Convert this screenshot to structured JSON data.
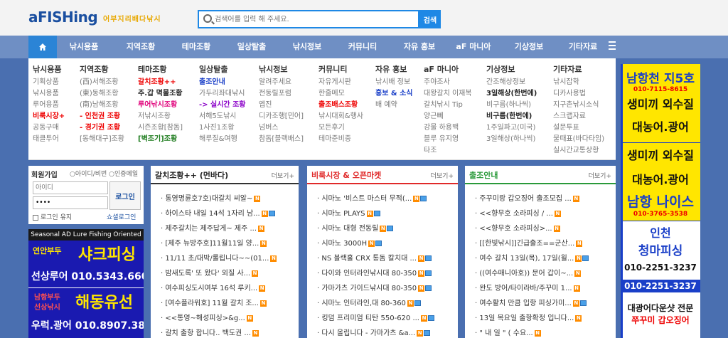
{
  "header": {
    "logo": "aFISHing",
    "logo_sub": "어부지리배다낚시",
    "search_placeholder": "검색어를 입력 해 주세요.",
    "search_button": "검색"
  },
  "nav": {
    "items": [
      "낚시용품",
      "지역조황",
      "테마조황",
      "일상탈출",
      "낚시정보",
      "커뮤니티",
      "자유 홍보",
      "aF 마니아",
      "기상정보",
      "기타자료"
    ]
  },
  "mega": {
    "columns": [
      {
        "title": "낚시용품",
        "items": [
          "기획상품",
          "낚시용품",
          "루어용품",
          "비룩시장+",
          "공동구매",
          "태클투어"
        ]
      },
      {
        "title": "지역조황",
        "items": [
          "(西)서해조황",
          "(東)동해조황",
          "(南)남해조황",
          "- 인천권 조황",
          "- 경기권 조황",
          "[동해대구]조황"
        ]
      },
      {
        "title": "테마조황",
        "items": [
          "갈치조황++",
          "주.갑 멱물조황",
          "루어낚시조황",
          "저낚시조황",
          "시즌조황[참돔]",
          "[벽조기]조황"
        ]
      },
      {
        "title": "일상탈출",
        "items": [
          "출조안내",
          "가두리좌대낚시",
          "-> 실시간 조황",
          "서해5도낚시",
          "1사진1조황",
          "해루질&여행"
        ]
      },
      {
        "title": "낚시정보",
        "items": [
          "알려주세요",
          "전동릴포럼",
          "엡진",
          "디카조행[민어]",
          "넘버스",
          "참돔[블랙배스]"
        ]
      },
      {
        "title": "커뮤니티",
        "items": [
          "자유게시판",
          "한줄메모",
          "출조배스조황",
          "낚시대회&행사",
          "모든후기",
          "테마준비중"
        ]
      },
      {
        "title": "자유 홍보",
        "items": [
          "낚시배 정보",
          "홍보 & 소식",
          "배 예약"
        ]
      },
      {
        "title": "aF 마니아",
        "items": [
          "주야조사",
          "대왕갈치 이재복",
          "갈치낚시 Tip",
          "양근뻬",
          "강물 하용백",
          "블루 유지영",
          "타조"
        ]
      },
      {
        "title": "기상정보",
        "items": [
          "간조해상정보",
          "3일해상(한번에)",
          "비구름(하나씩)",
          "비구름(한번에)",
          "1주일파고(미국)",
          "3일해상(하나씩)"
        ]
      },
      {
        "title": "기타자료",
        "items": [
          "낚시잡학",
          "디카사용법",
          "지구촌낚시소식",
          "스크랩자료",
          "설문투표",
          "물때표(바다타임)",
          "실시간교통상황"
        ]
      }
    ]
  },
  "login": {
    "title": "회원가입",
    "radio_id_pw": "아이디/비번",
    "radio_cert": "인증메일",
    "id_placeholder": "아이디",
    "pw_value": "....",
    "login_button": "로그인",
    "keep_login": "로그인 유지",
    "social_login": "쇼셜로그인"
  },
  "ad_left": {
    "topbar": "Seasonal AD Lure Fishing Oriented",
    "a_tag1": "연안부두",
    "a_title": "샤크피싱",
    "a_phone": "선상루어 010.5343.6604",
    "b_tag1": "남항부두",
    "b_tag2": "선상낚시",
    "b_title": "해동유선",
    "b_phone": "우럭.광어 010.8907.3866"
  },
  "ad_right": {
    "a_title": "남항천 지5호",
    "a_phone": "010-7115-8615",
    "a_l1": "생미끼 외수질",
    "a_l2": "대농어.광어",
    "b_l1": "생미끼 외수질",
    "b_l2": "대농어.광어",
    "b_title": "남항 나이스",
    "b_phone": "010-3765-3538",
    "c_l1": "인천",
    "c_title": "청마피싱",
    "c_phone1": "010-2251-3237",
    "c_phone2": "010-2251-3237",
    "d_l1": "대광어다운샷 전문",
    "d_l2": "쭈꾸미 갑오징어"
  },
  "boards": [
    {
      "title": "갈치조황++ (먼바다)",
      "more": "더보기+",
      "items": [
        "· 통영명륜호7호)대갈치 씨알~",
        "· 하이스타 내일 14석 1자리 남...",
        "· 제주갈치는 제주답게~ 제주 ...",
        "· [제주 뉴방주호]11월11일 양...",
        "· 11/11 초/대박/롤립니다~~(01...",
        "· 밤새도록' 또 왔다' 외질 사...",
        "· 여수피싱도시여부 16석 루키...",
        "· [여수플라워호] 11월 갈치 조...",
        "· <<통영~해성피싱>&g...",
        "· 갈치 출항 합니다.. 백도권 ..."
      ]
    },
    {
      "title": "비룩시장 & 오픈마켓",
      "more": "더보기+",
      "items": [
        "· 시마노 '비스트 마스터 무적(...",
        "· 시마노 PLAYS",
        "· 시마노 대형 전동릴",
        "· 시마노 3000H",
        "· NS 블랙홀 CRX 통돔 칼치대 ...",
        "· 다이와 인터라인낚시대 80-350",
        "· 가마가츠 가이드낚시대 80-350",
        "· 시마노 인터라인,대 80-360",
        "· 킹덤 프리미엄 티탄 550-620 ...",
        "· 다시 올립니다 - 가마가츠 &a..."
      ]
    },
    {
      "title": "출조안내",
      "more": "더보기+",
      "items": [
        "· 주꾸미랑 갑오징어 출조모집 ...",
        "· <<향무호 소라피싱 / ...",
        "· <<향무호 소라피싱>...",
        "· [[한빛낚시]]긴급출조==군산...",
        "· 여수 갈치 13일(목), 17일(월...",
        "· ((여수매니아호)) 문어 갑이~...",
        "· 완도 방어/타이라바/주꾸미 1...",
        "· 여수활치 만큼 입항 피싱가미...",
        "· 13일 목요일 출항확정 입니다...",
        "· \" 내 일 \" ( 수요..."
      ]
    }
  ],
  "colors": {
    "accent": "#1e88e5",
    "nav_bg": "#6f8fc4",
    "page_bg": "#4a6fb0",
    "red": "#e02a2a",
    "green": "#2a9a3a"
  }
}
